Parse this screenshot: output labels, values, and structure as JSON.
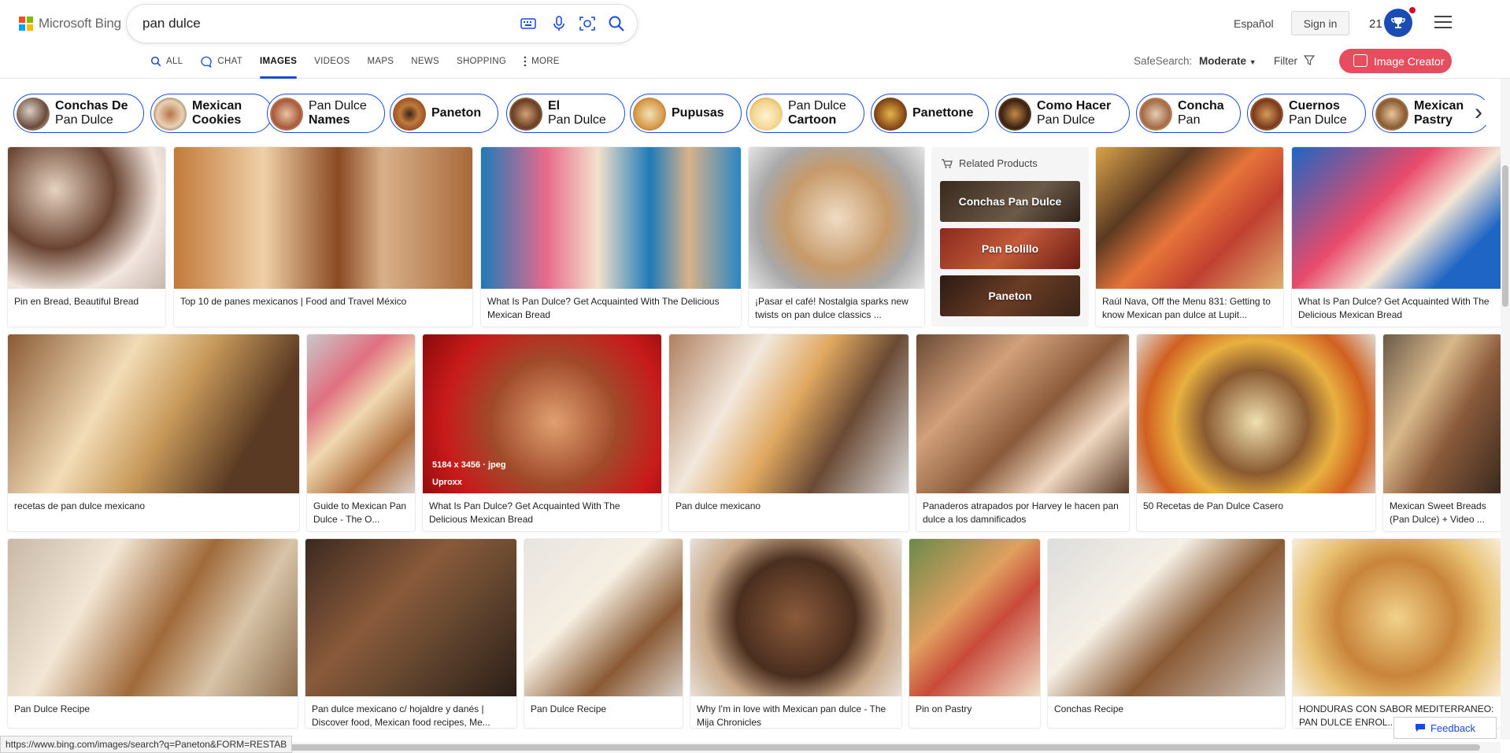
{
  "header": {
    "logo_text": "Microsoft Bing",
    "search_value": "pan dulce",
    "language_link": "Español",
    "signin_label": "Sign in",
    "rewards_count": "21",
    "image_creator_label": "Image Creator"
  },
  "nav": {
    "tabs": [
      {
        "label": "ALL",
        "icon": "search-icon"
      },
      {
        "label": "CHAT",
        "icon": "chat-icon"
      },
      {
        "label": "IMAGES",
        "icon": ""
      },
      {
        "label": "VIDEOS",
        "icon": ""
      },
      {
        "label": "MAPS",
        "icon": ""
      },
      {
        "label": "NEWS",
        "icon": ""
      },
      {
        "label": "SHOPPING",
        "icon": ""
      },
      {
        "label": "MORE",
        "icon": "more-vertical-icon"
      }
    ],
    "active_tab": "IMAGES",
    "safesearch_label": "SafeSearch:",
    "safesearch_value": "Moderate",
    "filter_label": "Filter"
  },
  "chips": [
    {
      "l1": "Conchas De",
      "l2": "Pan Dulce",
      "bold": "l1"
    },
    {
      "l1": "Mexican",
      "l2": "Cookies",
      "bold": "both"
    },
    {
      "l1": "Pan Dulce",
      "l2": "Names",
      "bold": "l2"
    },
    {
      "l1": "Paneton",
      "l2": "",
      "bold": "l1"
    },
    {
      "l1": "El",
      "l2": "Pan Dulce",
      "bold": "l1"
    },
    {
      "l1": "Pupusas",
      "l2": "",
      "bold": "l1"
    },
    {
      "l1": "Pan Dulce",
      "l2": "Cartoon",
      "bold": "l2"
    },
    {
      "l1": "Panettone",
      "l2": "",
      "bold": "l1"
    },
    {
      "l1": "Como Hacer",
      "l2": "Pan Dulce",
      "bold": "l1"
    },
    {
      "l1": "Concha",
      "l2": "Pan",
      "bold": "l1"
    },
    {
      "l1": "Cuernos",
      "l2": "Pan Dulce",
      "bold": "l1"
    },
    {
      "l1": "Mexican",
      "l2": "Pastry",
      "bold": "both"
    }
  ],
  "row1": [
    {
      "caption": "Pin en Bread, Beautiful Bread"
    },
    {
      "caption": "Top 10 de panes mexicanos | Food and Travel México"
    },
    {
      "caption": "What Is Pan Dulce? Get Acquainted With The Delicious Mexican Bread"
    },
    {
      "caption": "¡Pasar el café! Nostalgia sparks new twists on pan dulce classics ..."
    },
    {
      "caption": "Raúl Nava, Off the Menu 831: Getting to know Mexican pan dulce at Lupit..."
    },
    {
      "caption": "What Is Pan Dulce? Get Acquainted With The Delicious Mexican Bread"
    }
  ],
  "related": {
    "title": "Related Products",
    "items": [
      "Conchas Pan Dulce",
      "Pan Bolillo",
      "Paneton"
    ]
  },
  "row2": [
    {
      "caption": "recetas de pan dulce mexicano"
    },
    {
      "caption": "Guide to Mexican Pan Dulce - The O..."
    },
    {
      "caption": "What Is Pan Dulce? Get Acquainted With The Delicious Mexican Bread",
      "overlay_size": "5184 x 3456 · jpeg",
      "overlay_source": "Uproxx"
    },
    {
      "caption": "Pan dulce mexicano"
    },
    {
      "caption": "Panaderos atrapados por Harvey le hacen pan dulce a los damnificados"
    },
    {
      "caption": "50 Recetas de Pan Dulce Casero"
    },
    {
      "caption": "Mexican Sweet Breads (Pan Dulce) + Video ..."
    }
  ],
  "row3": [
    {
      "caption": "Pan Dulce Recipe"
    },
    {
      "caption": "Pan dulce mexicano c/ hojaldre y danés | Discover food, Mexican food recipes, Me..."
    },
    {
      "caption": "Pan Dulce Recipe"
    },
    {
      "caption": "Why I'm in love with Mexican pan dulce - The Mija Chronicles"
    },
    {
      "caption": "Pin on Pastry"
    },
    {
      "caption": "Conchas Recipe"
    },
    {
      "caption": "HONDURAS CON SABOR MEDITERRANEO: PAN DULCE ENROL..."
    }
  ],
  "status_url": "https://www.bing.com/images/search?q=Paneton&FORM=RESTAB",
  "feedback_label": "Feedback",
  "colors": {
    "accent": "#174ae4",
    "creator": "#e64e5f",
    "logo_red": "#f25022",
    "logo_green": "#7fba00",
    "logo_blue": "#00a4ef",
    "logo_yellow": "#ffb900"
  }
}
